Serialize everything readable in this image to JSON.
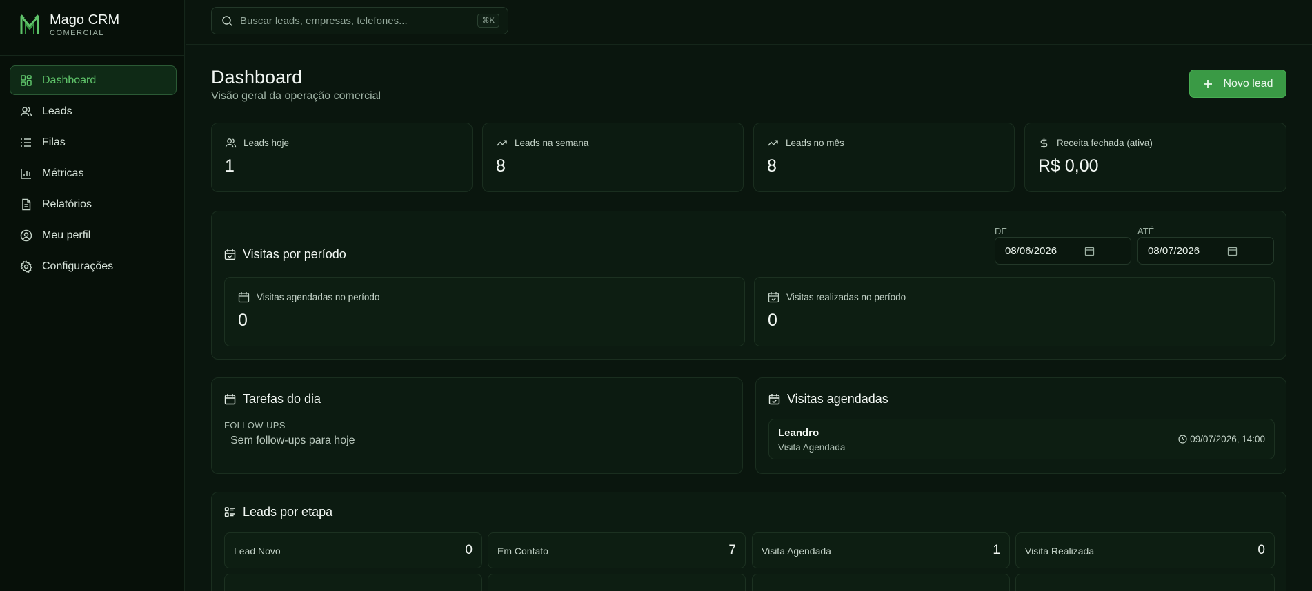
{
  "app": {
    "name": "Mago CRM",
    "subtitle": "COMERCIAL"
  },
  "sidebar": {
    "items": [
      {
        "label": "Dashboard",
        "icon": "dashboard-icon",
        "active": true
      },
      {
        "label": "Leads",
        "icon": "users-icon"
      },
      {
        "label": "Filas",
        "icon": "list-icon"
      },
      {
        "label": "Métricas",
        "icon": "bar-chart-icon"
      },
      {
        "label": "Relatórios",
        "icon": "file-text-icon"
      },
      {
        "label": "Meu perfil",
        "icon": "user-circle-icon"
      },
      {
        "label": "Configurações",
        "icon": "gear-icon"
      }
    ]
  },
  "search": {
    "placeholder": "Buscar leads, empresas, telefones...",
    "value": "",
    "shortcut": "⌘K"
  },
  "header": {
    "title": "Dashboard",
    "subtitle": "Visão geral da operação comercial",
    "new_lead_label": "Novo lead"
  },
  "stats": [
    {
      "label": "Leads hoje",
      "value": "1",
      "icon": "users-icon"
    },
    {
      "label": "Leads na semana",
      "value": "8",
      "icon": "trending-up-icon"
    },
    {
      "label": "Leads no mês",
      "value": "8",
      "icon": "trending-up-icon"
    },
    {
      "label": "Receita fechada (ativa)",
      "value": "R$ 0,00",
      "icon": "dollar-icon"
    }
  ],
  "visits_period": {
    "title": "Visitas por período",
    "from_label": "DE",
    "from_value": "08/06/2026",
    "to_label": "ATÉ",
    "to_value": "08/07/2026",
    "scheduled_label": "Visitas agendadas no período",
    "scheduled_value": "0",
    "done_label": "Visitas realizadas no período",
    "done_value": "0"
  },
  "tasks": {
    "title": "Tarefas do dia",
    "section_label": "FOLLOW-UPS",
    "empty_text": "Sem follow-ups para hoje"
  },
  "scheduled_visits": {
    "title": "Visitas agendadas",
    "items": [
      {
        "name": "Leandro",
        "status": "Visita Agendada",
        "datetime": "09/07/2026, 14:00"
      }
    ]
  },
  "stages": {
    "title": "Leads por etapa",
    "items": [
      {
        "label": "Lead Novo",
        "count": "0"
      },
      {
        "label": "Em Contato",
        "count": "7"
      },
      {
        "label": "Visita Agendada",
        "count": "1"
      },
      {
        "label": "Visita Realizada",
        "count": "0"
      }
    ]
  },
  "colors": {
    "accent": "#3a9a45",
    "active_text": "#5fc46a",
    "background": "#0a160e"
  }
}
